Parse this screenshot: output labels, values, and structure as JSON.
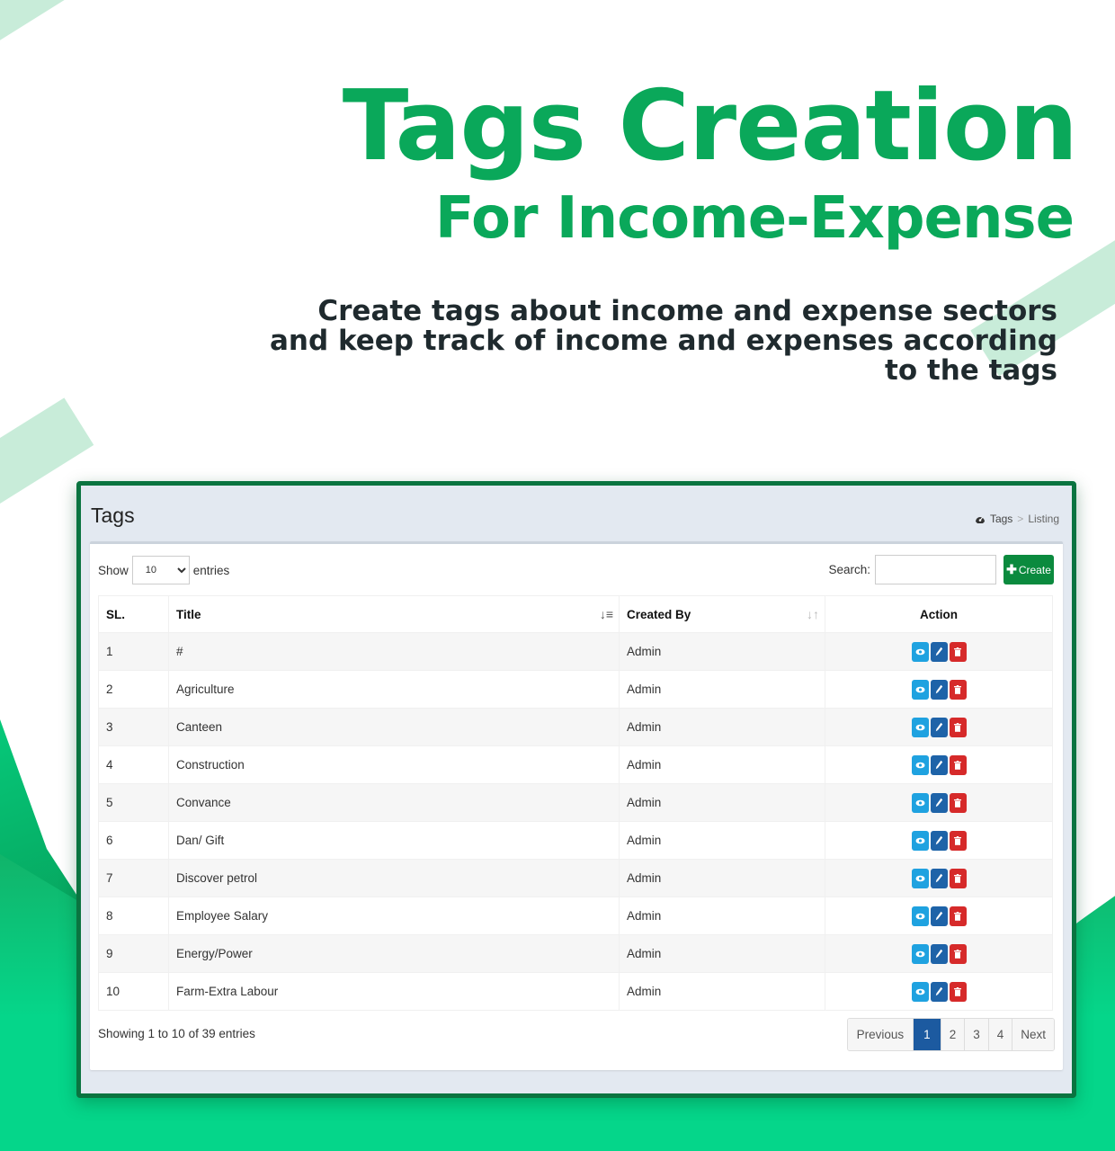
{
  "hero": {
    "title": "Tags Creation",
    "subtitle": "For Income-Expense",
    "description": "Create tags about income and expense sectors and keep track of income and expenses according to the tags"
  },
  "app": {
    "page_title": "Tags",
    "breadcrumb": {
      "icon": "dashboard-icon",
      "items": [
        "Tags",
        "Listing"
      ],
      "separator": ">"
    },
    "toolbar": {
      "show_label": "Show",
      "entries_value": "10",
      "entries_label": "entries",
      "search_label": "Search:",
      "search_value": "",
      "create_label": "Create",
      "create_icon": "plus-icon"
    },
    "table": {
      "columns": [
        "SL.",
        "Title",
        "Created By",
        "Action"
      ],
      "rows": [
        {
          "sl": "1",
          "title": "#",
          "created_by": "Admin"
        },
        {
          "sl": "2",
          "title": "Agriculture",
          "created_by": "Admin"
        },
        {
          "sl": "3",
          "title": "Canteen",
          "created_by": "Admin"
        },
        {
          "sl": "4",
          "title": "Construction",
          "created_by": "Admin"
        },
        {
          "sl": "5",
          "title": "Convance",
          "created_by": "Admin"
        },
        {
          "sl": "6",
          "title": "Dan/ Gift",
          "created_by": "Admin"
        },
        {
          "sl": "7",
          "title": "Discover petrol",
          "created_by": "Admin"
        },
        {
          "sl": "8",
          "title": "Employee Salary",
          "created_by": "Admin"
        },
        {
          "sl": "9",
          "title": "Energy/Power",
          "created_by": "Admin"
        },
        {
          "sl": "10",
          "title": "Farm-Extra Labour",
          "created_by": "Admin"
        }
      ],
      "row_actions": [
        "view",
        "edit",
        "delete"
      ]
    },
    "footer": {
      "info": "Showing 1 to 10 of 39 entries",
      "pagination": {
        "previous": "Previous",
        "pages": [
          "1",
          "2",
          "3",
          "4"
        ],
        "current": "1",
        "next": "Next"
      }
    }
  },
  "colors": {
    "brand_green": "#0aa85a",
    "frame_green": "#0a7440",
    "create_button": "#0b8a3e",
    "view_button": "#1fa2e0",
    "edit_button": "#1e63a8",
    "delete_button": "#d62a2a",
    "active_page": "#1c5aa0"
  }
}
